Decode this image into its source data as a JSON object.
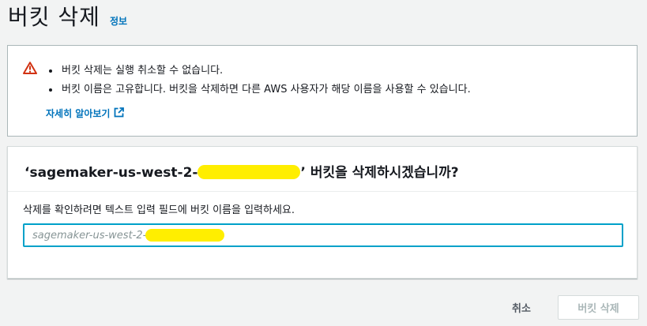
{
  "header": {
    "title": "버킷 삭제",
    "info_link": "정보"
  },
  "alert": {
    "icon": "warning-icon",
    "color": "#d13212",
    "items": [
      "버킷 삭제는 실행 취소할 수 없습니다.",
      "버킷 이름은 고유합니다. 버킷을 삭제하면 다른 AWS 사용자가 해당 이름을 사용할 수 있습니다."
    ],
    "learn_more": "자세히 알아보기"
  },
  "panel": {
    "heading_prefix": "‘sagemaker-us-west-2-",
    "heading_suffix": "’ 버킷을 삭제하시겠습니까?",
    "field_label": "삭제를 확인하려면 텍스트 입력 필드에 버킷 이름을 입력하세요.",
    "input_placeholder": "sagemaker-us-west-2-"
  },
  "footer": {
    "cancel_label": "취소",
    "delete_label": "버킷 삭제"
  }
}
